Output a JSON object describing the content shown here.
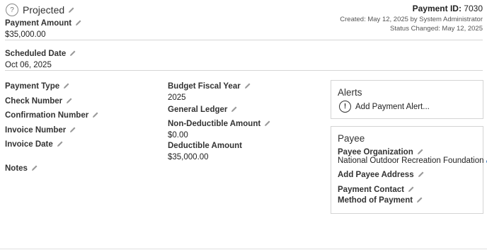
{
  "header": {
    "status": "Projected",
    "payment_id_label": "Payment ID:",
    "payment_id": "7030",
    "created": "Created: May 12, 2025 by System Administrator",
    "status_changed": "Status Changed: May 12, 2025"
  },
  "payment_amount": {
    "label": "Payment Amount",
    "value": "$35,000.00"
  },
  "scheduled_date": {
    "label": "Scheduled Date",
    "value": "Oct 06, 2025"
  },
  "left_fields": {
    "payment_type": "Payment Type",
    "check_number": "Check Number",
    "confirmation_number": "Confirmation Number",
    "invoice_number": "Invoice Number",
    "invoice_date": "Invoice Date",
    "notes": "Notes"
  },
  "mid_fields": {
    "budget_fiscal_year": {
      "label": "Budget Fiscal Year",
      "value": "2025"
    },
    "general_ledger": {
      "label": "General Ledger"
    },
    "non_deductible": {
      "label": "Non-Deductible Amount",
      "value": "$0.00"
    },
    "deductible": {
      "label": "Deductible Amount",
      "value": "$35,000.00"
    }
  },
  "alerts": {
    "title": "Alerts",
    "add_label": "Add Payment Alert..."
  },
  "payee": {
    "title": "Payee",
    "organization_label": "Payee Organization",
    "organization_value": "National Outdoor Recreation Foundation",
    "address_label": "Add Payee Address",
    "contact_label": "Payment Contact",
    "method_label": "Method of Payment"
  },
  "colors": {
    "link": "#2b6cb0",
    "divider": "#d6d6d6",
    "border": "#d4d4d4"
  }
}
